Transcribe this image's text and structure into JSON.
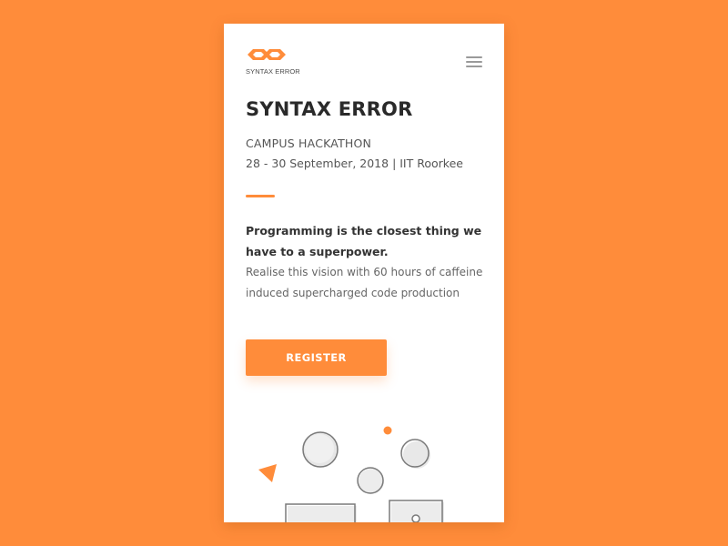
{
  "brand": {
    "logo_text": "SYNTAX ERROR",
    "accent_color": "#ff8c3a"
  },
  "header": {
    "menu_icon": "hamburger-menu-icon"
  },
  "hero": {
    "title": "SYNTAX ERROR",
    "subtitle": "CAMPUS HACKATHON",
    "date_location": "28 - 30 September, 2018 | IIT Roorkee",
    "tagline": "Programming is the closest thing we have to a superpower.",
    "description": "Realise this vision with 60 hours of caffeine induced supercharged code production"
  },
  "cta": {
    "register_label": "REGISTER"
  },
  "colors": {
    "background": "#ff8c3a",
    "card": "#ffffff",
    "text_dark": "#2a2a2a"
  }
}
